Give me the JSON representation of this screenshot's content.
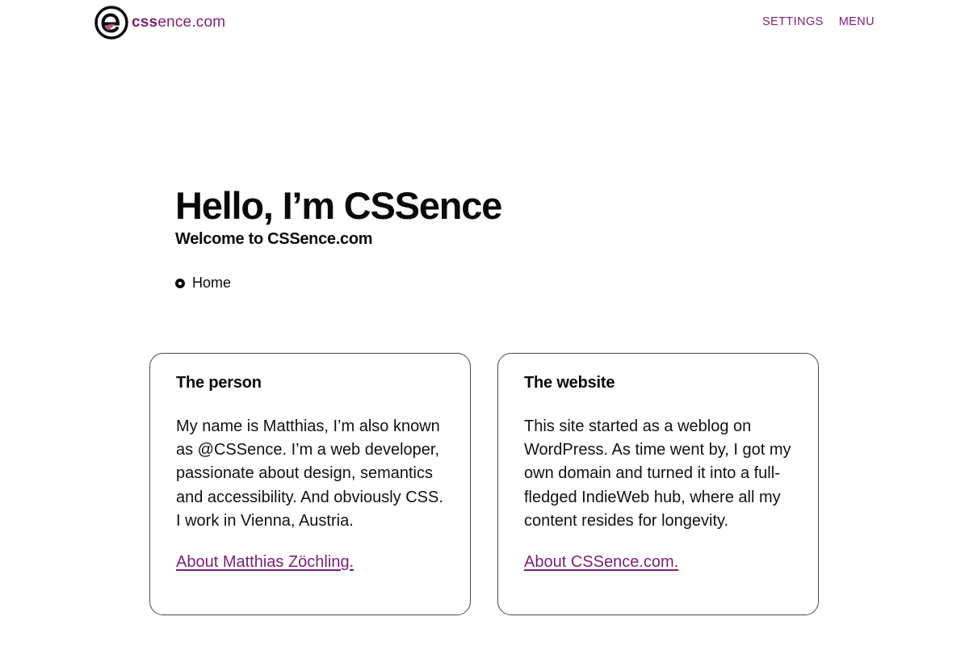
{
  "header": {
    "logo": {
      "text_bold": "css",
      "text_rest": "ence.com",
      "icon": "cssence-logo-icon"
    },
    "nav": {
      "settings_label": "SETTINGS",
      "menu_label": "MENU"
    }
  },
  "hero": {
    "title": "Hello, I’m CSSence",
    "subtitle": "Welcome to CSSence.com"
  },
  "breadcrumb": {
    "items": [
      {
        "label": "Home",
        "icon": "bullet-icon"
      }
    ]
  },
  "cards": [
    {
      "heading": "The person",
      "body": "My name is Matthias, I’m also known as @CSSence. I’m a web developer, passionate about design, semantics and accessibility. And obviously CSS. I work in Vienna, Austria.",
      "link_label": "About Matthias Zöchling."
    },
    {
      "heading": "The website",
      "body": "This site started as a weblog on WordPress. As time went by, I got my own domain and turned it into a full-fledged IndieWeb hub, where all my content resides for longevity.",
      "link_label": "About CSSence.com."
    }
  ],
  "colors": {
    "accent": "#7a1f73",
    "text": "#0a0a0a",
    "background": "#ffffff",
    "card_border": "#4a4a4a"
  }
}
